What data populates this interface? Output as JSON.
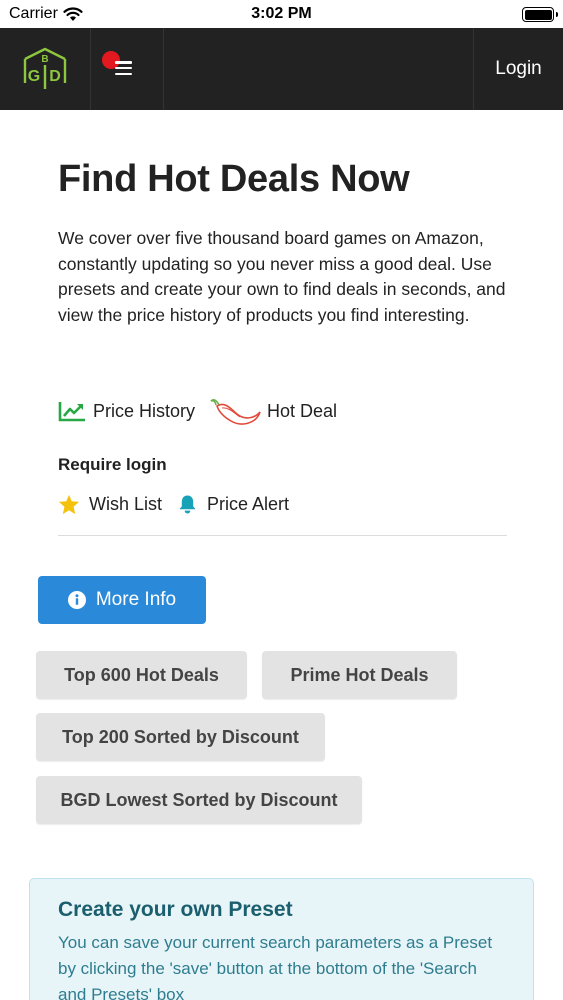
{
  "status_bar": {
    "carrier": "Carrier",
    "time": "3:02 PM"
  },
  "navbar": {
    "logo_text": "BGD",
    "login_label": "Login",
    "icons": {
      "logo": "bgd-logo-icon",
      "menu": "hamburger-menu-icon",
      "notification": "red-dot-badge"
    }
  },
  "hero": {
    "title": "Find Hot Deals Now",
    "description": "We cover over five thousand board games on Amazon, constantly updating so you never miss a good deal. Use presets and create your own to find deals in seconds, and view the price history of products you find interesting."
  },
  "legend": {
    "price_history": "Price History",
    "hot_deal": "Hot Deal",
    "require_login": "Require login",
    "wish_list": "Wish List",
    "price_alert": "Price Alert"
  },
  "buttons": {
    "more_info": "More Info",
    "top600": "Top 600 Hot Deals",
    "prime": "Prime Hot Deals",
    "top200": "Top 200 Sorted by Discount",
    "bgd_lowest": "BGD Lowest Sorted by Discount"
  },
  "preset_box": {
    "title": "Create your own Preset",
    "body": "You can save your current search parameters as a Preset by clicking the 'save' button at the bottom of the 'Search and Presets' box"
  },
  "colors": {
    "navbar_bg": "#222222",
    "primary_button": "#2a8ad9",
    "logo_green": "#8dc63f",
    "chart_green": "#28a745",
    "star_gold": "#f4c20d",
    "bell_teal": "#17a2b8",
    "pepper_red": "#e24b3b",
    "info_box_bg": "#e8f5f8",
    "info_title": "#1b5e6e"
  }
}
